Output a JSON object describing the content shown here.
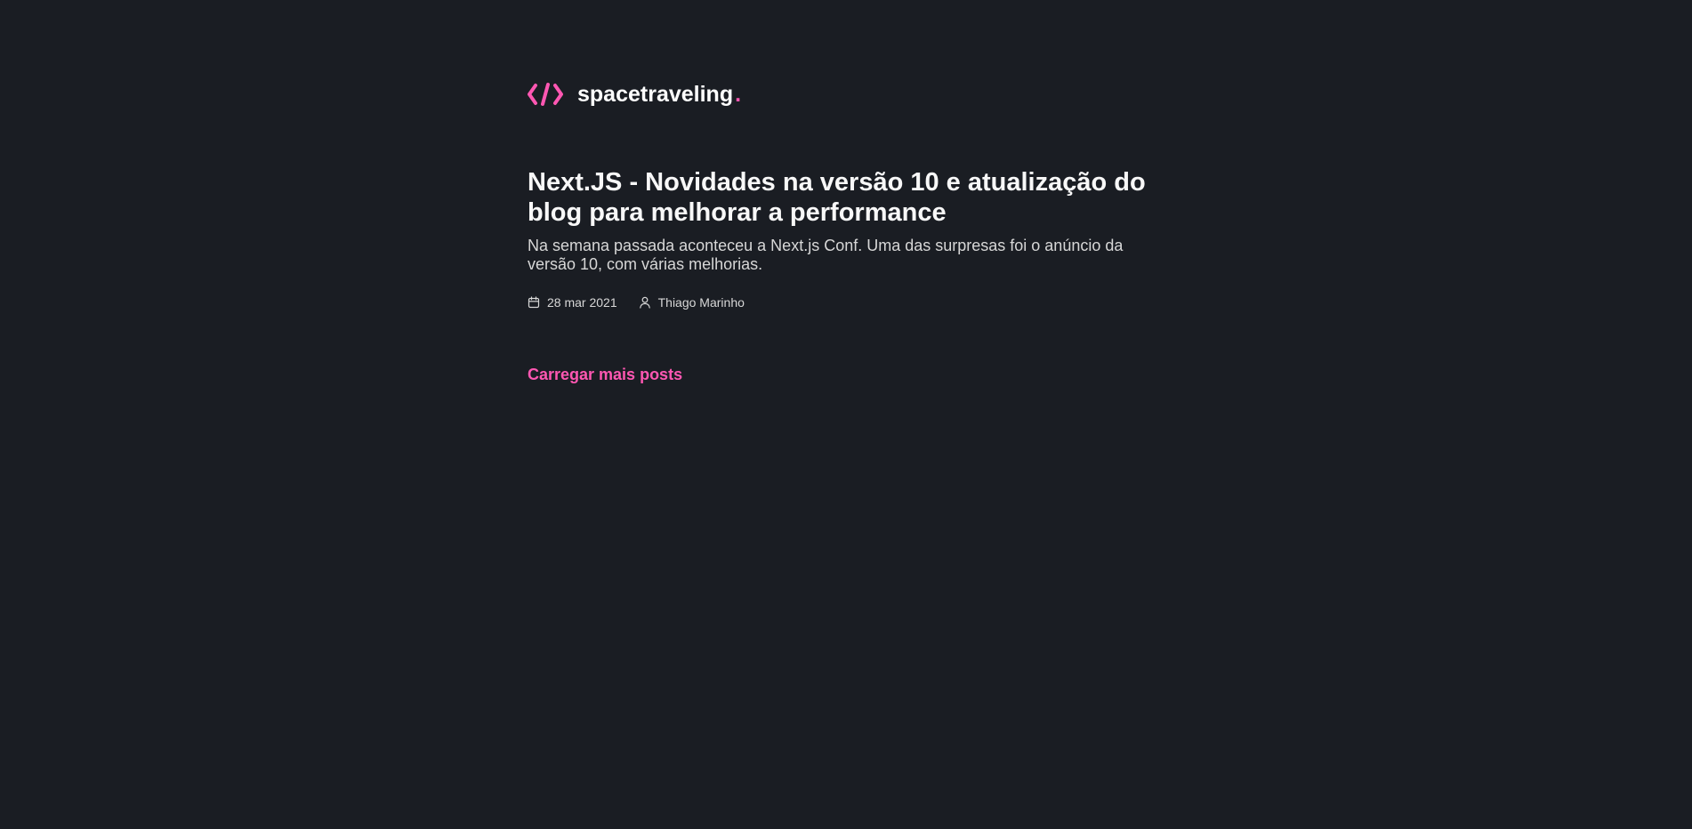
{
  "header": {
    "logo_icon": "code-brackets-icon",
    "brand_name": "spacetraveling",
    "brand_dot": ".",
    "accent_color": "#ff57b2"
  },
  "posts": [
    {
      "title": "Next.JS - Novidades na versão 10 e atualização do blog para melhorar a performance",
      "subtitle": "Na semana passada aconteceu a Next.js Conf. Uma das surpresas foi o anúncio da versão 10, com várias melhorias.",
      "date_icon": "calendar-icon",
      "date": "28 mar 2021",
      "author_icon": "user-icon",
      "author": "Thiago Marinho"
    }
  ],
  "load_more_label": "Carregar mais posts",
  "colors": {
    "background": "#1a1d23",
    "heading": "#f8f8f8",
    "body_text": "#d7d7d7",
    "accent": "#ff57b2"
  }
}
